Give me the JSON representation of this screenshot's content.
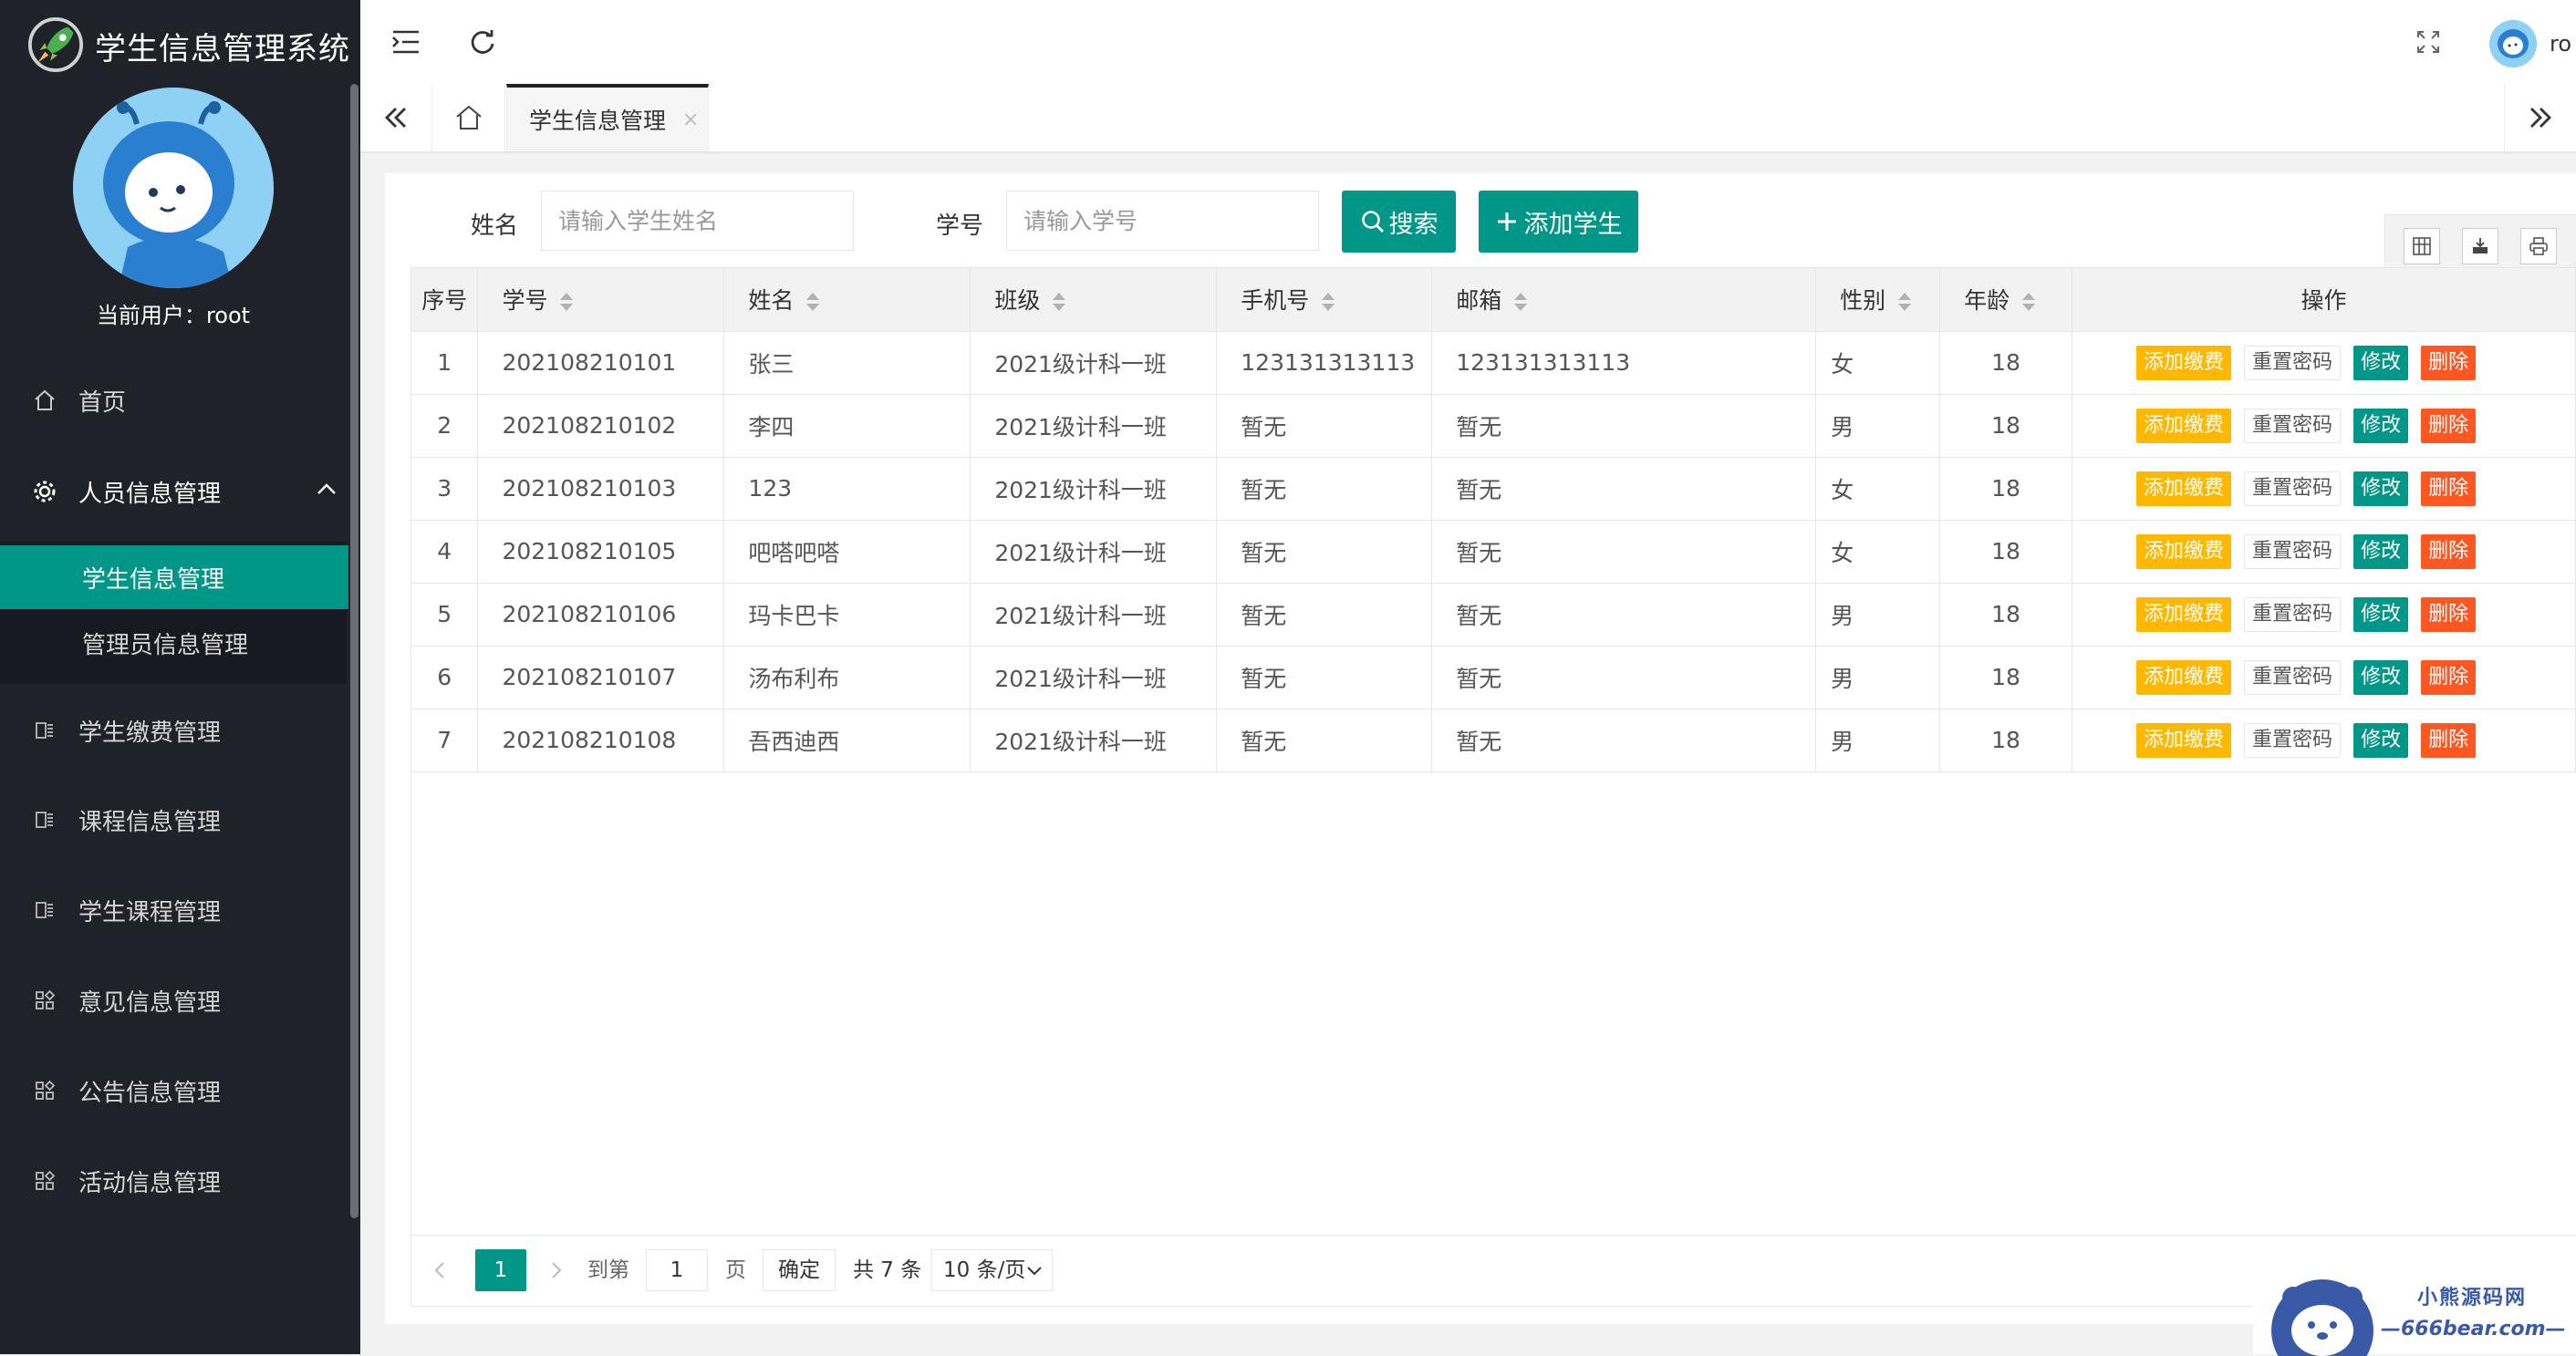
{
  "app": {
    "title": "学生信息管理系统"
  },
  "sidebar": {
    "current_user_label": "当前用户：",
    "current_user": "root",
    "items": [
      {
        "label": "首页",
        "icon": "home-icon"
      },
      {
        "label": "人员信息管理",
        "icon": "gear-icon",
        "expanded": true
      },
      {
        "label": "学生缴费管理",
        "icon": "list-icon"
      },
      {
        "label": "课程信息管理",
        "icon": "list-icon"
      },
      {
        "label": "学生课程管理",
        "icon": "list-icon"
      },
      {
        "label": "意见信息管理",
        "icon": "apps-icon"
      },
      {
        "label": "公告信息管理",
        "icon": "apps-icon"
      },
      {
        "label": "活动信息管理",
        "icon": "apps-icon"
      }
    ],
    "sub_items": [
      {
        "label": "学生信息管理",
        "active": true
      },
      {
        "label": "管理员信息管理",
        "active": false
      }
    ]
  },
  "header": {
    "user_name": "ro"
  },
  "tabs": {
    "active_label": "学生信息管理",
    "close": "×"
  },
  "search": {
    "name_label": "姓名",
    "name_placeholder": "请输入学生姓名",
    "id_label": "学号",
    "id_placeholder": "请输入学号",
    "search_button": "搜索",
    "add_button": "添加学生"
  },
  "table": {
    "columns": [
      "序号",
      "学号",
      "姓名",
      "班级",
      "手机号",
      "邮箱",
      "性别",
      "年龄",
      "操作"
    ],
    "rows": [
      [
        "1",
        "202108210101",
        "张三",
        "2021级计科一班",
        "123131313113",
        "123131313113",
        "女",
        "18"
      ],
      [
        "2",
        "202108210102",
        "李四",
        "2021级计科一班",
        "暂无",
        "暂无",
        "男",
        "18"
      ],
      [
        "3",
        "202108210103",
        "123",
        "2021级计科一班",
        "暂无",
        "暂无",
        "女",
        "18"
      ],
      [
        "4",
        "202108210105",
        "吧嗒吧嗒",
        "2021级计科一班",
        "暂无",
        "暂无",
        "女",
        "18"
      ],
      [
        "5",
        "202108210106",
        "玛卡巴卡",
        "2021级计科一班",
        "暂无",
        "暂无",
        "男",
        "18"
      ],
      [
        "6",
        "202108210107",
        "汤布利布",
        "2021级计科一班",
        "暂无",
        "暂无",
        "男",
        "18"
      ],
      [
        "7",
        "202108210108",
        "吾西迪西",
        "2021级计科一班",
        "暂无",
        "暂无",
        "男",
        "18"
      ]
    ],
    "actions": [
      "添加缴费",
      "重置密码",
      "修改",
      "删除"
    ]
  },
  "pager": {
    "current_page": "1",
    "goto_label": "到第",
    "goto_value": "1",
    "page_unit": "页",
    "confirm": "确定",
    "total": "共 7 条",
    "page_size": "10 条/页"
  },
  "watermark": {
    "cn": "小熊源码网",
    "en": "—666bear.com—"
  },
  "colors": {
    "accent": "#009688",
    "sidebar": "#20222a",
    "warm": "#ffb800",
    "danger": "#ff5722"
  }
}
